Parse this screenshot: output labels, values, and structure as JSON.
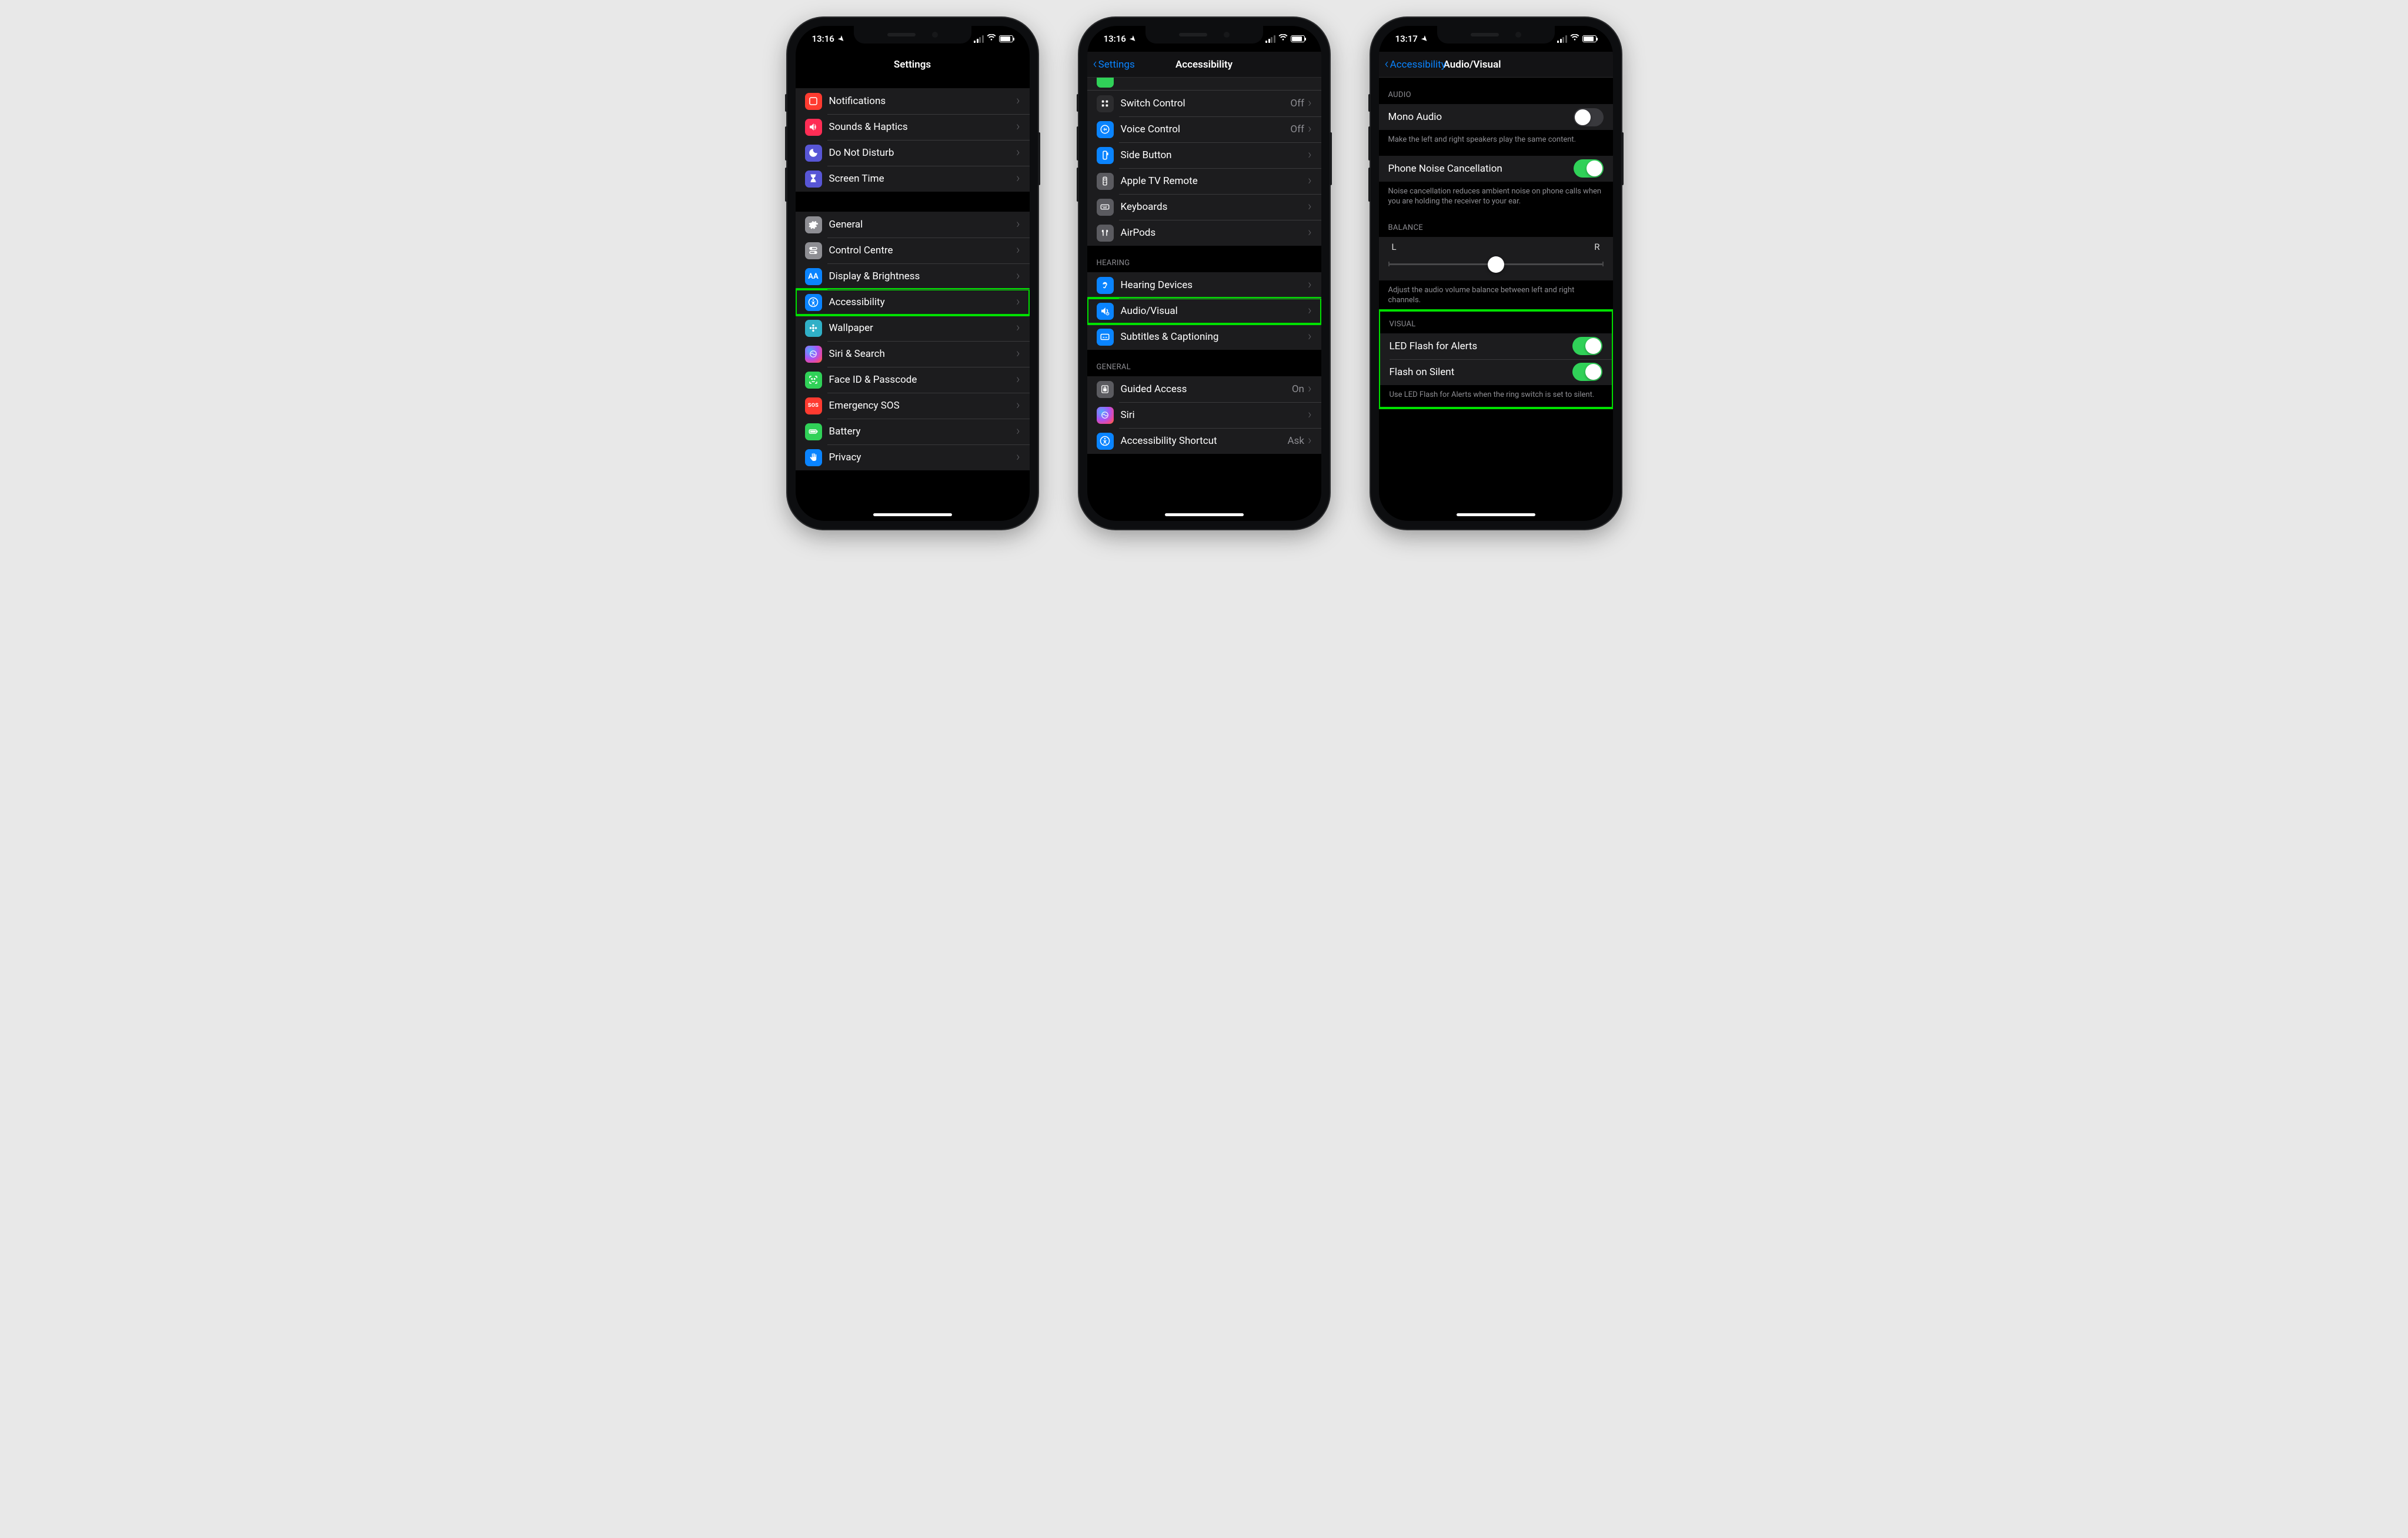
{
  "status": {
    "time1": "13:16",
    "time2": "13:16",
    "time3": "13:17"
  },
  "p1": {
    "title": "Settings",
    "g1": [
      {
        "k": "notifications",
        "label": "Notifications",
        "color": "ic-red",
        "icon": "square"
      },
      {
        "k": "sounds",
        "label": "Sounds & Haptics",
        "color": "ic-pink",
        "icon": "speaker"
      },
      {
        "k": "dnd",
        "label": "Do Not Disturb",
        "color": "ic-purple",
        "icon": "moon"
      },
      {
        "k": "screentime",
        "label": "Screen Time",
        "color": "ic-purple",
        "icon": "hourglass"
      }
    ],
    "g2": [
      {
        "k": "general",
        "label": "General",
        "color": "ic-grey",
        "icon": "gear"
      },
      {
        "k": "control",
        "label": "Control Centre",
        "color": "ic-grey",
        "icon": "switches"
      },
      {
        "k": "display",
        "label": "Display & Brightness",
        "color": "ic-blue",
        "icon": "aa"
      },
      {
        "k": "accessibility",
        "label": "Accessibility",
        "color": "ic-blue",
        "icon": "access",
        "hilite": true
      },
      {
        "k": "wallpaper",
        "label": "Wallpaper",
        "color": "ic-teal",
        "icon": "flower"
      },
      {
        "k": "siri",
        "label": "Siri & Search",
        "color": "ic-siri",
        "icon": "siri"
      },
      {
        "k": "faceid",
        "label": "Face ID & Passcode",
        "color": "ic-green",
        "icon": "face"
      },
      {
        "k": "sos",
        "label": "Emergency SOS",
        "color": "ic-sos",
        "icon": "sos"
      },
      {
        "k": "battery",
        "label": "Battery",
        "color": "ic-green",
        "icon": "battery"
      },
      {
        "k": "privacy",
        "label": "Privacy",
        "color": "ic-blue",
        "icon": "hand"
      }
    ]
  },
  "p2": {
    "back": "Settings",
    "title": "Accessibility",
    "g1": [
      {
        "k": "switch",
        "label": "Switch Control",
        "value": "Off",
        "color": "ic-black",
        "icon": "grid"
      },
      {
        "k": "voice",
        "label": "Voice Control",
        "value": "Off",
        "color": "ic-blue",
        "icon": "voice"
      },
      {
        "k": "side",
        "label": "Side Button",
        "color": "ic-blue",
        "icon": "side"
      },
      {
        "k": "tv",
        "label": "Apple TV Remote",
        "color": "ic-dgrey",
        "icon": "remote"
      },
      {
        "k": "kb",
        "label": "Keyboards",
        "color": "ic-dgrey",
        "icon": "keyboard"
      },
      {
        "k": "airpods",
        "label": "AirPods",
        "color": "ic-dgrey",
        "icon": "airpods"
      }
    ],
    "sh2": "HEARING",
    "g2": [
      {
        "k": "hearing",
        "label": "Hearing Devices",
        "color": "ic-blue",
        "icon": "ear"
      },
      {
        "k": "av",
        "label": "Audio/Visual",
        "color": "ic-blue",
        "icon": "av",
        "hilite": true
      },
      {
        "k": "subs",
        "label": "Subtitles & Captioning",
        "color": "ic-blue",
        "icon": "subs"
      }
    ],
    "sh3": "GENERAL",
    "g3": [
      {
        "k": "guided",
        "label": "Guided Access",
        "value": "On",
        "color": "ic-dgrey",
        "icon": "lock"
      },
      {
        "k": "siri",
        "label": "Siri",
        "color": "ic-siri",
        "icon": "siri"
      },
      {
        "k": "shortcut",
        "label": "Accessibility Shortcut",
        "value": "Ask",
        "color": "ic-blue",
        "icon": "access"
      }
    ]
  },
  "p3": {
    "back": "Accessibility",
    "title": "Audio/Visual",
    "sh1": "AUDIO",
    "mono": {
      "label": "Mono Audio",
      "on": false
    },
    "mono_f": "Make the left and right speakers play the same content.",
    "noise": {
      "label": "Phone Noise Cancellation",
      "on": true
    },
    "noise_f": "Noise cancellation reduces ambient noise on phone calls when you are holding the receiver to your ear.",
    "bal_h": "BALANCE",
    "bal_l": "L",
    "bal_r": "R",
    "bal_f": "Adjust the audio volume balance between left and right channels.",
    "sh2": "VISUAL",
    "led": {
      "label": "LED Flash for Alerts",
      "on": true
    },
    "silent": {
      "label": "Flash on Silent",
      "on": true
    },
    "vis_f": "Use LED Flash for Alerts when the ring switch is set to silent."
  }
}
